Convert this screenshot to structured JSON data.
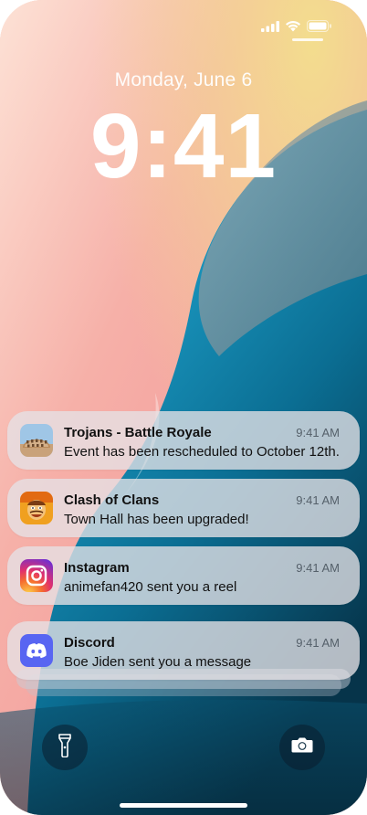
{
  "lock_screen": {
    "date": "Monday, June 6",
    "time": "9:41"
  },
  "status_bar": {
    "icons": [
      "cellular-signal-icon",
      "wifi-icon",
      "battery-icon"
    ]
  },
  "notifications": [
    {
      "app": "Trojans - Battle Royale",
      "message": "Event has been rescheduled to October 12th.",
      "time": "9:41 AM",
      "icon": "colosseum-app-icon"
    },
    {
      "app": "Clash of Clans",
      "message": "Town Hall has been upgraded!",
      "time": "9:41 AM",
      "icon": "clash-of-clans-app-icon"
    },
    {
      "app": "Instagram",
      "message": "animefan420 sent you a reel",
      "time": "9:41 AM",
      "icon": "instagram-app-icon"
    },
    {
      "app": "Discord",
      "message": "Boe Jiden sent you a message",
      "time": "9:41 AM",
      "icon": "discord-app-icon"
    }
  ],
  "quick_actions": {
    "left": "flashlight-icon",
    "right": "camera-icon"
  },
  "colors": {
    "instagram_gradient": [
      "#f9ce34",
      "#ee2a7b",
      "#6228d7"
    ],
    "discord": "#5865f2",
    "wallpaper_teal": "#0a7da6",
    "wallpaper_pink": "#f4a6a0"
  }
}
